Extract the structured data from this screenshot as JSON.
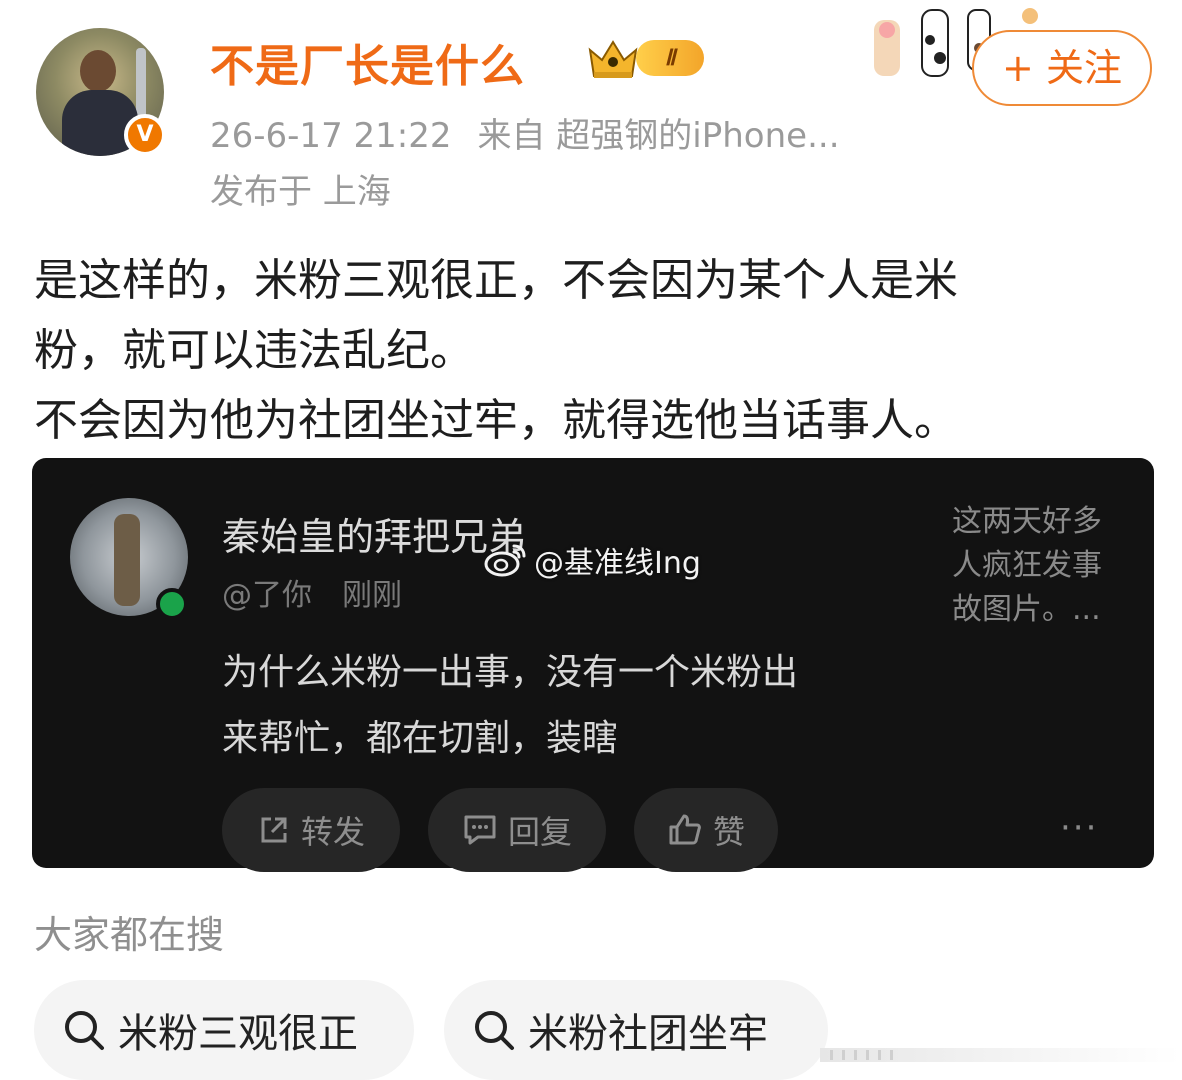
{
  "post": {
    "username": "不是厂长是什么",
    "level": "Ⅱ",
    "verified_mark": "V",
    "timestamp": "26-6-17 21:22",
    "source": "来自 超强钢的iPhone...",
    "location": "发布于 上海",
    "follow_label": "+ 关注",
    "text_lines": [
      "是这样的，米粉三观很正，不会因为某个人是米",
      "粉，就可以违法乱纪。",
      "不会因为他为社团坐过牢，就得选他当话事人。"
    ]
  },
  "embedded": {
    "name": "秦始皇的拜把兄弟",
    "handle": "@了你",
    "time": "刚刚",
    "side_text": "这两天好多人疯狂发事故图片。...",
    "body_lines": [
      "为什么米粉一出事，没有一个米粉出",
      "来帮忙，都在切割，装瞎"
    ],
    "actions": {
      "repost": "转发",
      "reply": "回复",
      "like": "赞"
    },
    "more": "···"
  },
  "watermark": "@基准线Ing",
  "search": {
    "title": "大家都在搜",
    "chips": [
      "米粉三观很正",
      "米粉社团坐牢"
    ]
  },
  "icons": [
    "crown-icon",
    "verified-icon",
    "paw-icon",
    "share-icon",
    "comment-icon",
    "thumbs-up-icon",
    "weibo-logo-icon",
    "search-icon",
    "more-icon"
  ],
  "colors": {
    "accent_orange": "#ef6a16",
    "card_bg": "#121212",
    "verified_orange": "#f07800",
    "online_green": "#1aa34a"
  }
}
